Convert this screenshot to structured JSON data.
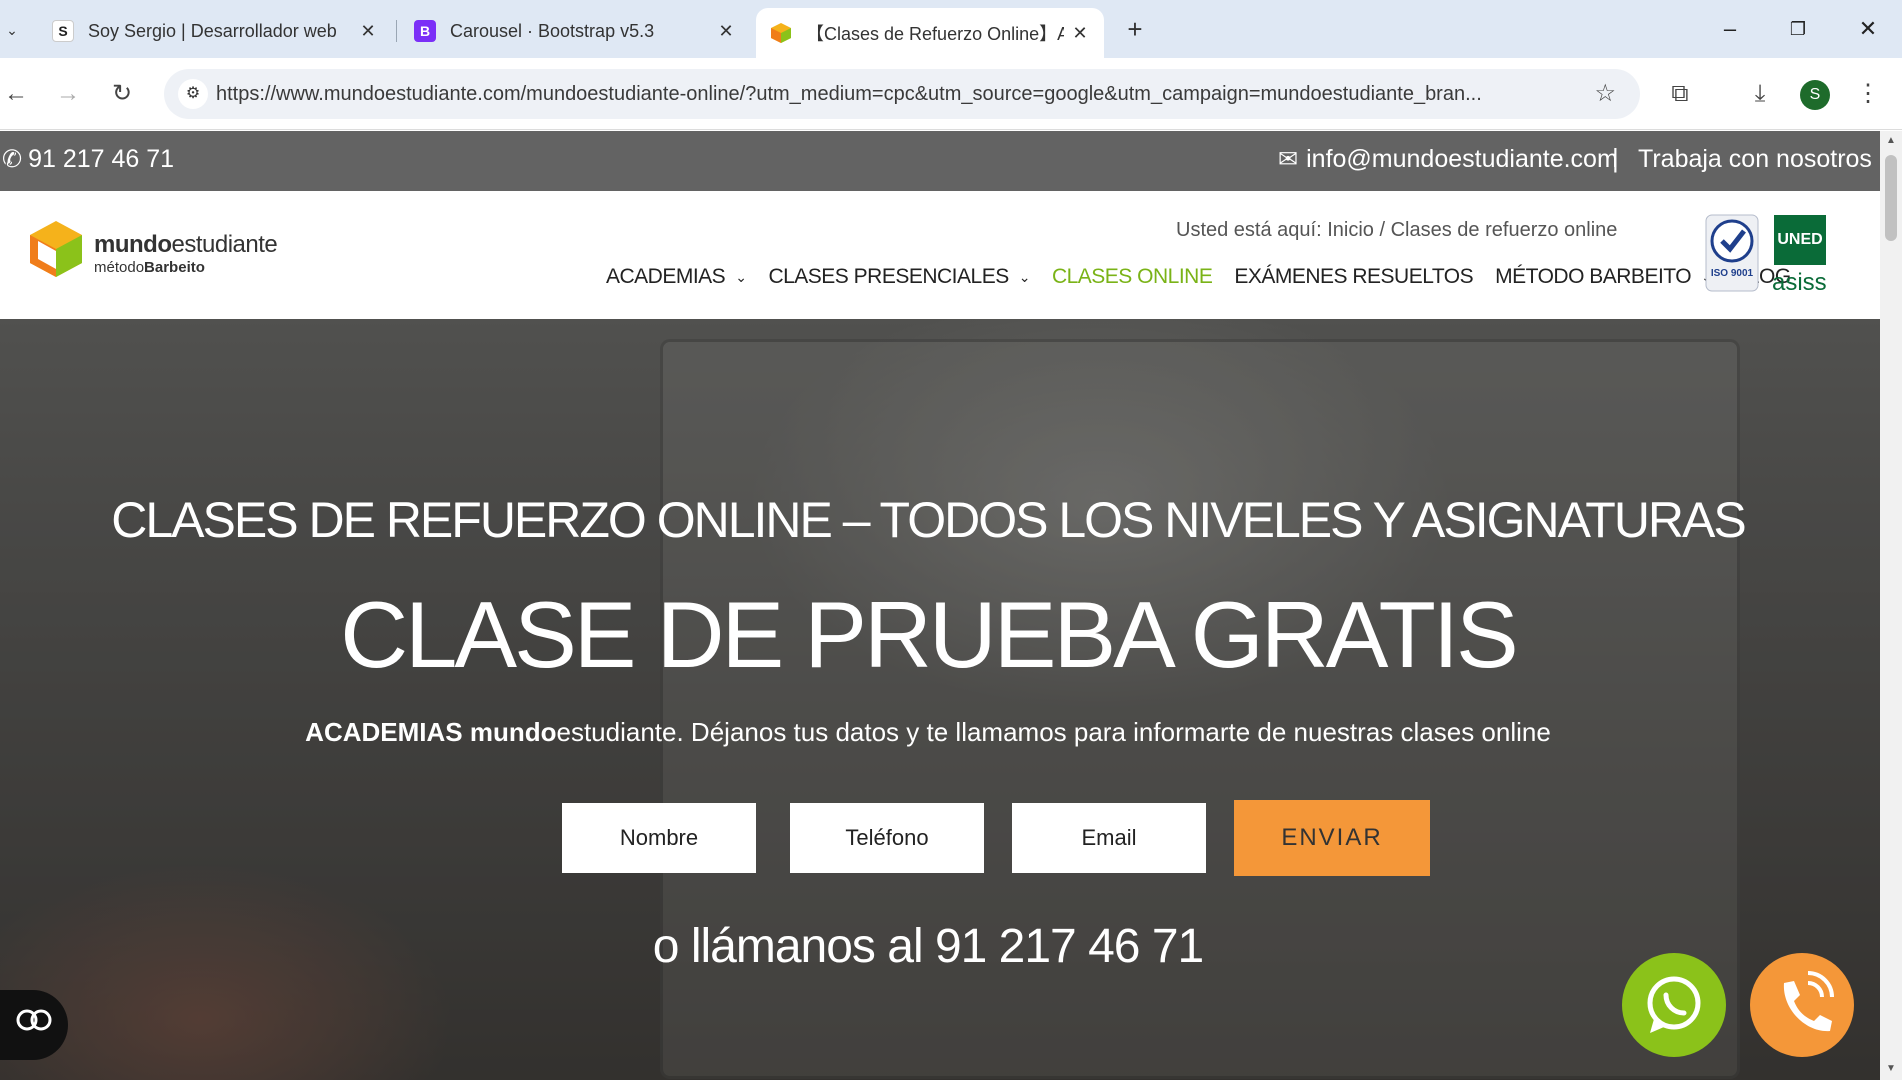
{
  "browser": {
    "tabs": [
      {
        "favicon": "S",
        "title": "Soy Sergio | Desarrollador web",
        "close": "✕"
      },
      {
        "favicon": "B",
        "title": "Carousel · Bootstrap v5.3",
        "close": "✕"
      },
      {
        "favicon": "",
        "title": "【Clases de Refuerzo Online】Ac",
        "close": "✕"
      }
    ],
    "new_tab": "+",
    "url": "https://www.mundoestudiante.com/mundoestudiante-online/?utm_medium=cpc&utm_source=google&utm_campaign=mundoestudiante_bran...",
    "profile_initial": "S"
  },
  "topbar": {
    "phone": "91 217 46 71",
    "email": "info@mundoestudiante.com",
    "separator": "|",
    "jobs": "Trabaja con nosotros"
  },
  "header": {
    "logo": {
      "name_bold": "mundo",
      "name_rest": "estudiante",
      "sub_light": "método",
      "sub_bold": "Barbeito"
    },
    "breadcrumb": {
      "prefix": "Usted está aquí:",
      "home": "Inicio",
      "sep": "/",
      "current": "Clases de refuerzo online"
    },
    "nav": [
      {
        "label": "ACADEMIAS",
        "has_dropdown": true
      },
      {
        "label": "CLASES PRESENCIALES",
        "has_dropdown": true
      },
      {
        "label": "CLASES ONLINE",
        "active": true
      },
      {
        "label": "EXÁMENES RESUELTOS"
      },
      {
        "label": "MÉTODO BARBEITO",
        "has_dropdown": true
      },
      {
        "label": "BLOG"
      }
    ],
    "iso_label": "ISO 9001",
    "uned_label": "UNED",
    "asiss_label": "asiss"
  },
  "hero": {
    "subtitle": "CLASES DE REFUERZO ONLINE – TODOS LOS NIVELES Y ASIGNATURAS",
    "title": "CLASE DE PRUEBA GRATIS",
    "text_bold": "ACADEMIAS mundo",
    "text_rest": "estudiante. Déjanos tus datos y te llamamos para informarte de nuestras clases online",
    "form": {
      "name_placeholder": "Nombre",
      "phone_placeholder": "Teléfono",
      "email_placeholder": "Email",
      "submit_label": "ENVIAR"
    },
    "call_line": "o llámanos al 91 217 46 71"
  },
  "colors": {
    "topbar_bg": "#636363",
    "active_nav": "#7ab317",
    "accent_orange": "#f49739",
    "whatsapp_green": "#8bc21a",
    "uned_green": "#0a6b38"
  },
  "icons": [
    "phone-icon",
    "mail-icon",
    "accessibility-icon",
    "whatsapp-icon",
    "phone-call-icon"
  ]
}
